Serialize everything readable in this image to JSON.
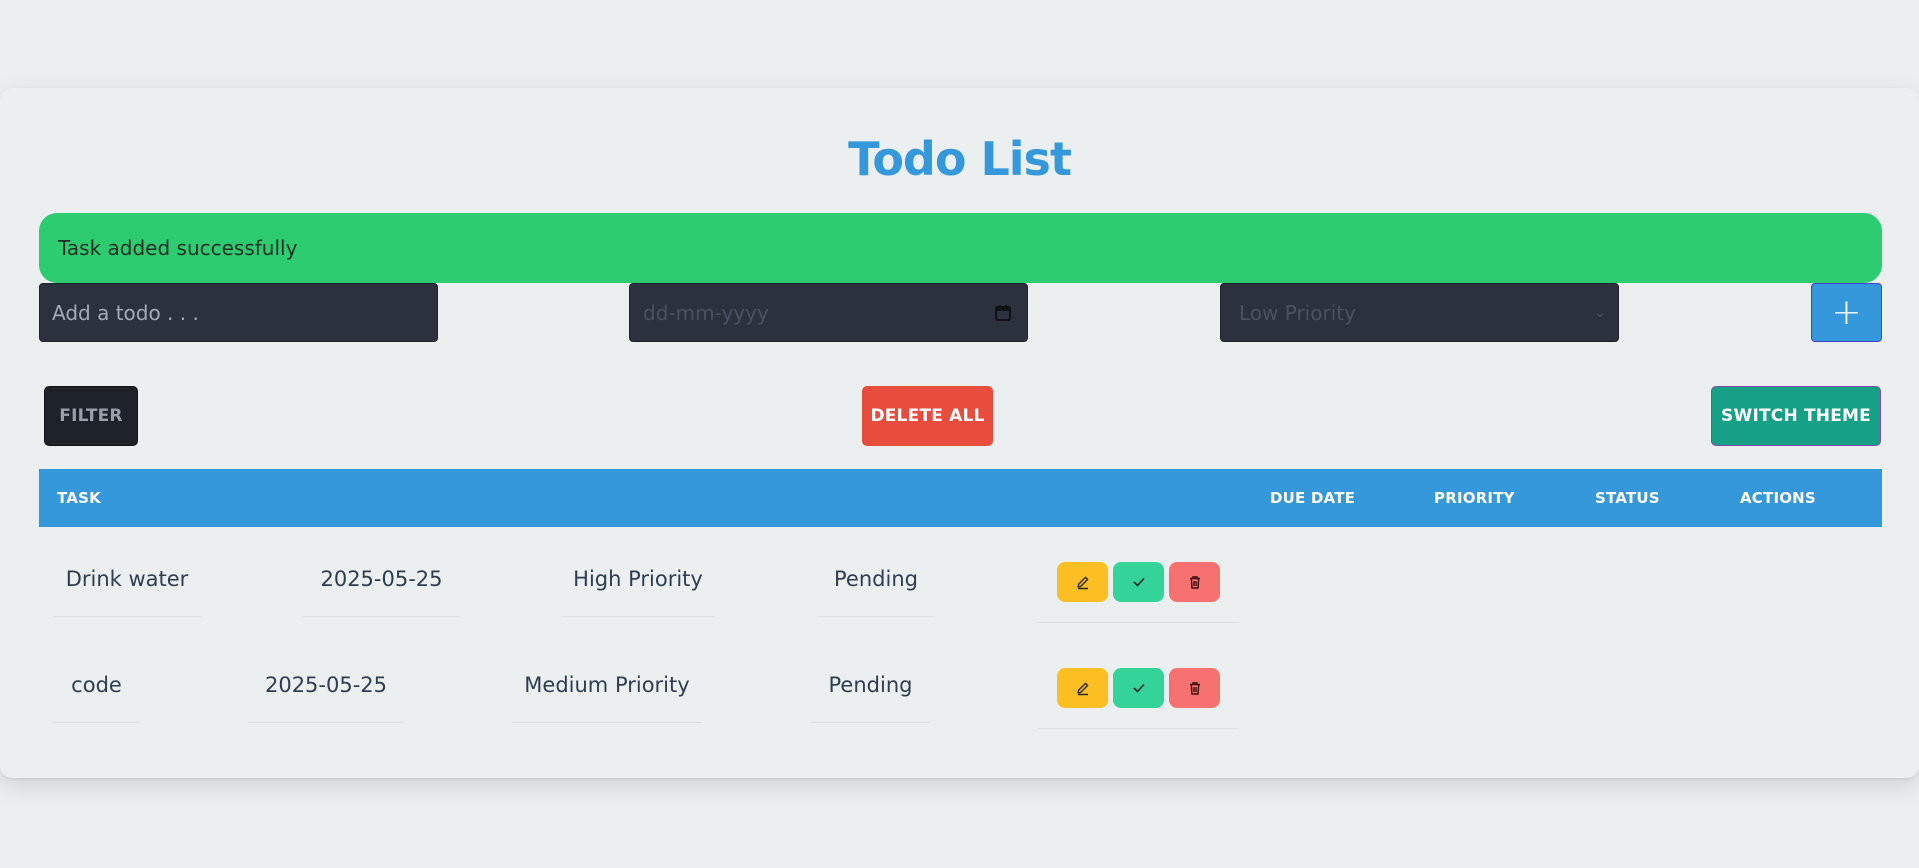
{
  "page": {
    "title": "Todo List"
  },
  "alert": {
    "message": "Task added successfully"
  },
  "form": {
    "todo_placeholder": "Add a todo . . .",
    "date_placeholder": "dd-mm-yyyy",
    "priority_selected": "Low Priority",
    "add_label": "+"
  },
  "toolbar": {
    "filter_label": "FILTER",
    "delete_all_label": "DELETE ALL",
    "switch_theme_label": "SWITCH THEME"
  },
  "table": {
    "headers": {
      "task": "TASK",
      "due_date": "DUE DATE",
      "priority": "PRIORITY",
      "status": "STATUS",
      "actions": "ACTIONS"
    },
    "rows": [
      {
        "task": "Drink water",
        "due_date": "2025-05-25",
        "priority": "High Priority",
        "status": "Pending"
      },
      {
        "task": "code",
        "due_date": "2025-05-25",
        "priority": "Medium Priority",
        "status": "Pending"
      }
    ]
  },
  "colors": {
    "accent": "#3498db",
    "success": "#2ecc71",
    "danger": "#e74c3c",
    "theme": "#16a085",
    "edit": "#fbbf24",
    "complete": "#34d399",
    "delete": "#f87171"
  },
  "icons": {
    "calendar": "calendar-icon",
    "chevron": "chevron-down-icon",
    "edit": "pencil-icon",
    "complete": "check-icon",
    "delete": "trash-icon"
  }
}
